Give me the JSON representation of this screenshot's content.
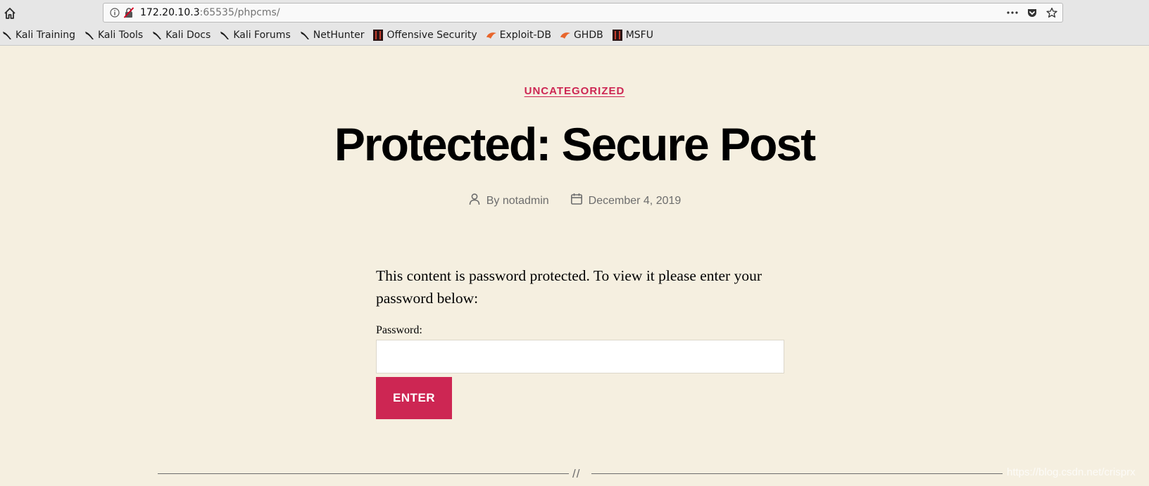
{
  "browser": {
    "url_host": "172.20.10.3",
    "url_path": ":65535/phpcms/",
    "icons": {
      "home": "home-icon",
      "info": "info-icon",
      "insecure": "insecure-lock-icon",
      "more": "more-icon",
      "pocket": "pocket-icon",
      "bookmark": "bookmark-star-icon"
    },
    "bookmarks": [
      {
        "label": "Kali Training",
        "icon": "kali-dragon-icon"
      },
      {
        "label": "Kali Tools",
        "icon": "kali-dragon-icon"
      },
      {
        "label": "Kali Docs",
        "icon": "kali-dragon-icon"
      },
      {
        "label": "Kali Forums",
        "icon": "kali-dragon-icon"
      },
      {
        "label": "NetHunter",
        "icon": "kali-dragon-icon"
      },
      {
        "label": "Offensive Security",
        "icon": "offsec-icon"
      },
      {
        "label": "Exploit-DB",
        "icon": "exploit-db-icon"
      },
      {
        "label": "GHDB",
        "icon": "exploit-db-icon"
      },
      {
        "label": "MSFU",
        "icon": "offsec-icon"
      }
    ]
  },
  "post": {
    "category": "UNCATEGORIZED",
    "title": "Protected: Secure Post",
    "author_prefix": "By",
    "author": "notadmin",
    "date": "December 4, 2019",
    "protected_message": "This content is password protected. To view it please enter your password below:",
    "password_label": "Password:",
    "password_value": "",
    "submit_label": "ENTER",
    "separator": "//"
  },
  "watermark": "https://blog.csdn.net/crisprx",
  "colors": {
    "background": "#f5efe0",
    "accent": "#cd2653",
    "meta_text": "#6d6d6d"
  }
}
